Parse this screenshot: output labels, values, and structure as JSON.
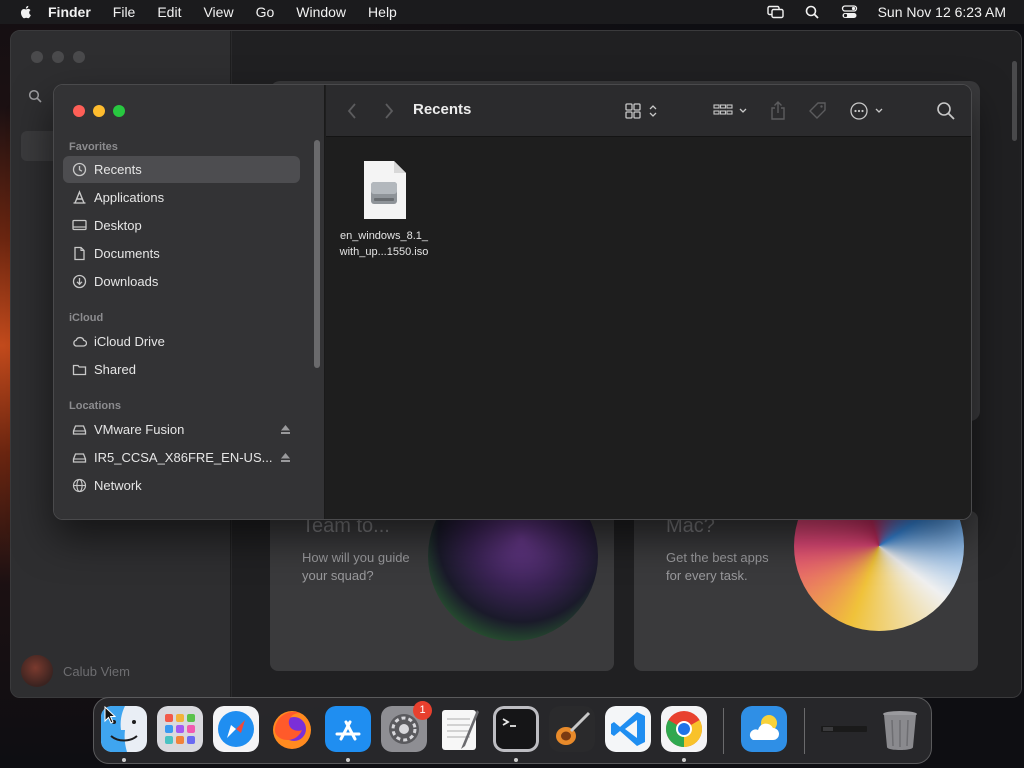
{
  "menubar": {
    "app_name": "Finder",
    "menus": [
      "File",
      "Edit",
      "View",
      "Go",
      "Window",
      "Help"
    ],
    "clock": "Sun Nov 12  6:23 AM",
    "icons": [
      "apple-icon",
      "screen-mirroring-icon",
      "spotlight-icon",
      "control-center-icon"
    ]
  },
  "background_window": {
    "user_name": "Calub Viem",
    "cards": [
      {
        "title": "Team to...",
        "description": "How will you guide your squad?"
      },
      {
        "title": "Mac?",
        "description": "Get the best apps for every task."
      }
    ]
  },
  "finder": {
    "title": "Recents",
    "sidebar": {
      "sections": [
        {
          "heading": "Favorites",
          "items": [
            {
              "label": "Recents",
              "icon": "clock-icon",
              "selected": true
            },
            {
              "label": "Applications",
              "icon": "applications-icon"
            },
            {
              "label": "Desktop",
              "icon": "desktop-icon"
            },
            {
              "label": "Documents",
              "icon": "document-icon"
            },
            {
              "label": "Downloads",
              "icon": "download-icon"
            }
          ]
        },
        {
          "heading": "iCloud",
          "items": [
            {
              "label": "iCloud Drive",
              "icon": "cloud-icon"
            },
            {
              "label": "Shared",
              "icon": "shared-folder-icon"
            }
          ]
        },
        {
          "heading": "Locations",
          "items": [
            {
              "label": "VMware Fusion",
              "icon": "drive-icon",
              "ejectable": true
            },
            {
              "label": "IR5_CCSA_X86FRE_EN-US...",
              "icon": "drive-icon",
              "ejectable": true
            },
            {
              "label": "Network",
              "icon": "network-icon"
            }
          ]
        }
      ]
    },
    "files": [
      {
        "name_line1": "en_windows_8.1_",
        "name_line2": "with_up...1550.iso",
        "icon": "disk-image-icon"
      }
    ]
  },
  "dock": {
    "apps": [
      {
        "name": "Finder",
        "running": true
      },
      {
        "name": "Launchpad",
        "running": false
      },
      {
        "name": "Safari",
        "running": false
      },
      {
        "name": "Firefox",
        "running": false
      },
      {
        "name": "App Store",
        "running": true
      },
      {
        "name": "System Settings",
        "running": false,
        "badge": "1"
      },
      {
        "name": "TextEdit",
        "running": false
      },
      {
        "name": "Terminal",
        "running": true
      },
      {
        "name": "GarageBand",
        "running": false
      },
      {
        "name": "Visual Studio Code",
        "running": false
      },
      {
        "name": "Google Chrome",
        "running": true
      },
      {
        "name": "Weather",
        "running": false
      },
      {
        "name": "Minimized Window",
        "running": false
      },
      {
        "name": "Trash",
        "running": false
      }
    ]
  },
  "colors": {
    "close": "#fe5f57",
    "minimize": "#febc2e",
    "maximize": "#28c840",
    "badge": "#e8402e",
    "selection": "#4d4d50"
  }
}
